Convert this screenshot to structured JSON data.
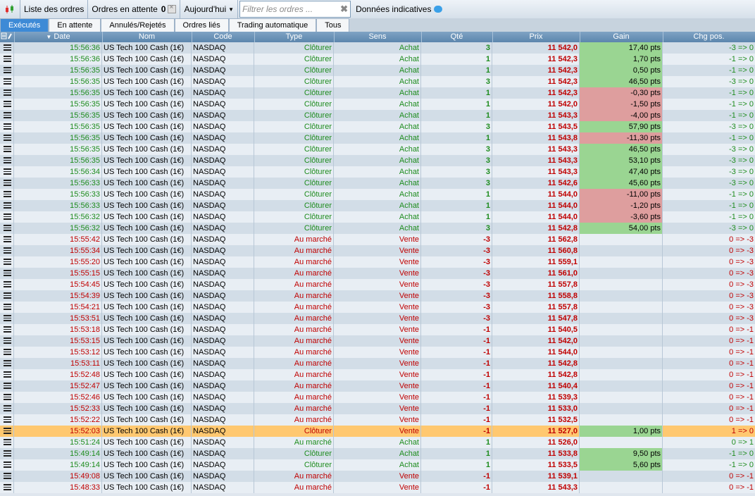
{
  "toolbar": {
    "list_label": "Liste des ordres",
    "pending_label": "Ordres en attente",
    "pending_count": "0",
    "period": "Aujourd'hui",
    "filter_placeholder": "Filtrer les ordres ...",
    "indicative_label": "Données indicatives"
  },
  "tabs": [
    "Exécutés",
    "En attente",
    "Annulés/Rejetés",
    "Ordres liés",
    "Trading automatique",
    "Tous"
  ],
  "columns": [
    "Date",
    "Nom",
    "Code",
    "Type",
    "Sens",
    "Qté",
    "Prix",
    "Gain",
    "Chg pos."
  ],
  "colors": {
    "buy": "#1e8c1e",
    "sell": "#c00000",
    "gain_pos": "#9ad592",
    "gain_neg": "#de9e9e",
    "highlight": "#ffc870",
    "active_tab": "#3d8ad6"
  },
  "rows": [
    [
      "15:56:36",
      "US Tech 100 Cash (1€)",
      "NASDAQ",
      "Clôturer",
      "Achat",
      "3",
      "11 542,0",
      "17,40 pts",
      "-3 => 0"
    ],
    [
      "15:56:36",
      "US Tech 100 Cash (1€)",
      "NASDAQ",
      "Clôturer",
      "Achat",
      "1",
      "11 542,3",
      "1,70 pts",
      "-1 => 0"
    ],
    [
      "15:56:35",
      "US Tech 100 Cash (1€)",
      "NASDAQ",
      "Clôturer",
      "Achat",
      "1",
      "11 542,3",
      "0,50 pts",
      "-1 => 0"
    ],
    [
      "15:56:35",
      "US Tech 100 Cash (1€)",
      "NASDAQ",
      "Clôturer",
      "Achat",
      "3",
      "11 542,3",
      "46,50 pts",
      "-3 => 0"
    ],
    [
      "15:56:35",
      "US Tech 100 Cash (1€)",
      "NASDAQ",
      "Clôturer",
      "Achat",
      "1",
      "11 542,3",
      "-0,30 pts",
      "-1 => 0"
    ],
    [
      "15:56:35",
      "US Tech 100 Cash (1€)",
      "NASDAQ",
      "Clôturer",
      "Achat",
      "1",
      "11 542,0",
      "-1,50 pts",
      "-1 => 0"
    ],
    [
      "15:56:35",
      "US Tech 100 Cash (1€)",
      "NASDAQ",
      "Clôturer",
      "Achat",
      "1",
      "11 543,3",
      "-4,00 pts",
      "-1 => 0"
    ],
    [
      "15:56:35",
      "US Tech 100 Cash (1€)",
      "NASDAQ",
      "Clôturer",
      "Achat",
      "3",
      "11 543,5",
      "57,90 pts",
      "-3 => 0"
    ],
    [
      "15:56:35",
      "US Tech 100 Cash (1€)",
      "NASDAQ",
      "Clôturer",
      "Achat",
      "1",
      "11 543,8",
      "-11,30 pts",
      "-1 => 0"
    ],
    [
      "15:56:35",
      "US Tech 100 Cash (1€)",
      "NASDAQ",
      "Clôturer",
      "Achat",
      "3",
      "11 543,3",
      "46,50 pts",
      "-3 => 0"
    ],
    [
      "15:56:35",
      "US Tech 100 Cash (1€)",
      "NASDAQ",
      "Clôturer",
      "Achat",
      "3",
      "11 543,3",
      "53,10 pts",
      "-3 => 0"
    ],
    [
      "15:56:34",
      "US Tech 100 Cash (1€)",
      "NASDAQ",
      "Clôturer",
      "Achat",
      "3",
      "11 543,3",
      "47,40 pts",
      "-3 => 0"
    ],
    [
      "15:56:33",
      "US Tech 100 Cash (1€)",
      "NASDAQ",
      "Clôturer",
      "Achat",
      "3",
      "11 542,6",
      "45,60 pts",
      "-3 => 0"
    ],
    [
      "15:56:33",
      "US Tech 100 Cash (1€)",
      "NASDAQ",
      "Clôturer",
      "Achat",
      "1",
      "11 544,0",
      "-11,00 pts",
      "-1 => 0"
    ],
    [
      "15:56:33",
      "US Tech 100 Cash (1€)",
      "NASDAQ",
      "Clôturer",
      "Achat",
      "1",
      "11 544,0",
      "-1,20 pts",
      "-1 => 0"
    ],
    [
      "15:56:32",
      "US Tech 100 Cash (1€)",
      "NASDAQ",
      "Clôturer",
      "Achat",
      "1",
      "11 544,0",
      "-3,60 pts",
      "-1 => 0"
    ],
    [
      "15:56:32",
      "US Tech 100 Cash (1€)",
      "NASDAQ",
      "Clôturer",
      "Achat",
      "3",
      "11 542,8",
      "54,00 pts",
      "-3 => 0"
    ],
    [
      "15:55:42",
      "US Tech 100 Cash (1€)",
      "NASDAQ",
      "Au marché",
      "Vente",
      "-3",
      "11 562,8",
      "",
      "0 => -3"
    ],
    [
      "15:55:34",
      "US Tech 100 Cash (1€)",
      "NASDAQ",
      "Au marché",
      "Vente",
      "-3",
      "11 560,8",
      "",
      "0 => -3"
    ],
    [
      "15:55:20",
      "US Tech 100 Cash (1€)",
      "NASDAQ",
      "Au marché",
      "Vente",
      "-3",
      "11 559,1",
      "",
      "0 => -3"
    ],
    [
      "15:55:15",
      "US Tech 100 Cash (1€)",
      "NASDAQ",
      "Au marché",
      "Vente",
      "-3",
      "11 561,0",
      "",
      "0 => -3"
    ],
    [
      "15:54:45",
      "US Tech 100 Cash (1€)",
      "NASDAQ",
      "Au marché",
      "Vente",
      "-3",
      "11 557,8",
      "",
      "0 => -3"
    ],
    [
      "15:54:39",
      "US Tech 100 Cash (1€)",
      "NASDAQ",
      "Au marché",
      "Vente",
      "-3",
      "11 558,8",
      "",
      "0 => -3"
    ],
    [
      "15:54:21",
      "US Tech 100 Cash (1€)",
      "NASDAQ",
      "Au marché",
      "Vente",
      "-3",
      "11 557,8",
      "",
      "0 => -3"
    ],
    [
      "15:53:51",
      "US Tech 100 Cash (1€)",
      "NASDAQ",
      "Au marché",
      "Vente",
      "-3",
      "11 547,8",
      "",
      "0 => -3"
    ],
    [
      "15:53:18",
      "US Tech 100 Cash (1€)",
      "NASDAQ",
      "Au marché",
      "Vente",
      "-1",
      "11 540,5",
      "",
      "0 => -1"
    ],
    [
      "15:53:15",
      "US Tech 100 Cash (1€)",
      "NASDAQ",
      "Au marché",
      "Vente",
      "-1",
      "11 542,0",
      "",
      "0 => -1"
    ],
    [
      "15:53:12",
      "US Tech 100 Cash (1€)",
      "NASDAQ",
      "Au marché",
      "Vente",
      "-1",
      "11 544,0",
      "",
      "0 => -1"
    ],
    [
      "15:53:11",
      "US Tech 100 Cash (1€)",
      "NASDAQ",
      "Au marché",
      "Vente",
      "-1",
      "11 542,8",
      "",
      "0 => -1"
    ],
    [
      "15:52:48",
      "US Tech 100 Cash (1€)",
      "NASDAQ",
      "Au marché",
      "Vente",
      "-1",
      "11 542,8",
      "",
      "0 => -1"
    ],
    [
      "15:52:47",
      "US Tech 100 Cash (1€)",
      "NASDAQ",
      "Au marché",
      "Vente",
      "-1",
      "11 540,4",
      "",
      "0 => -1"
    ],
    [
      "15:52:46",
      "US Tech 100 Cash (1€)",
      "NASDAQ",
      "Au marché",
      "Vente",
      "-1",
      "11 539,3",
      "",
      "0 => -1"
    ],
    [
      "15:52:33",
      "US Tech 100 Cash (1€)",
      "NASDAQ",
      "Au marché",
      "Vente",
      "-1",
      "11 533,0",
      "",
      "0 => -1"
    ],
    [
      "15:52:22",
      "US Tech 100 Cash (1€)",
      "NASDAQ",
      "Au marché",
      "Vente",
      "-1",
      "11 532,5",
      "",
      "0 => -1"
    ],
    [
      "15:52:03",
      "US Tech 100 Cash (1€)",
      "NASDAQ",
      "Clôturer",
      "Vente",
      "-1",
      "11 527,0",
      "1,00 pts",
      "1 => 0"
    ],
    [
      "15:51:24",
      "US Tech 100 Cash (1€)",
      "NASDAQ",
      "Au marché",
      "Achat",
      "1",
      "11 526,0",
      "",
      "0 => 1"
    ],
    [
      "15:49:14",
      "US Tech 100 Cash (1€)",
      "NASDAQ",
      "Clôturer",
      "Achat",
      "1",
      "11 533,8",
      "9,50 pts",
      "-1 => 0"
    ],
    [
      "15:49:14",
      "US Tech 100 Cash (1€)",
      "NASDAQ",
      "Clôturer",
      "Achat",
      "1",
      "11 533,5",
      "5,60 pts",
      "-1 => 0"
    ],
    [
      "15:49:08",
      "US Tech 100 Cash (1€)",
      "NASDAQ",
      "Au marché",
      "Vente",
      "-1",
      "11 539,1",
      "",
      "0 => -1"
    ],
    [
      "15:48:33",
      "US Tech 100 Cash (1€)",
      "NASDAQ",
      "Au marché",
      "Vente",
      "-1",
      "11 543,3",
      "",
      "0 => -1"
    ]
  ]
}
